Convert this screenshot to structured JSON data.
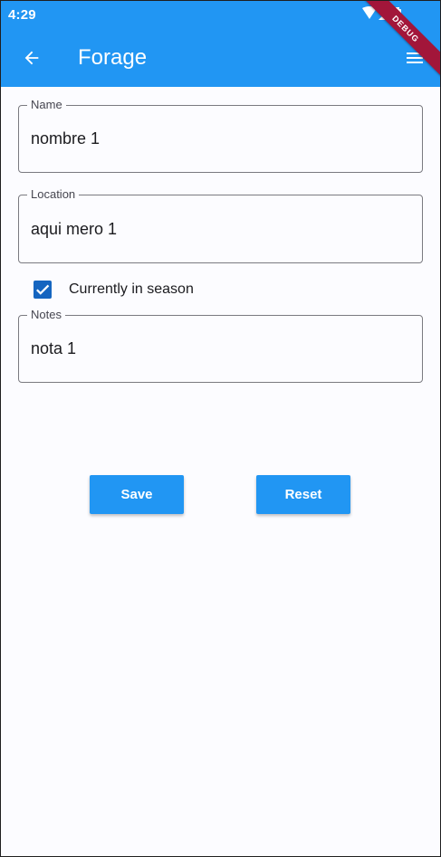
{
  "status_bar": {
    "time": "4:29",
    "icons": [
      "wifi-icon",
      "signal-icon",
      "battery-icon"
    ],
    "debug_banner": "DEBUG"
  },
  "app_bar": {
    "title": "Forage",
    "back_icon": "arrow-back-icon",
    "menu_icon": "menu-icon",
    "color": "#2196f3"
  },
  "form": {
    "name": {
      "label": "Name",
      "value": "nombre 1"
    },
    "location": {
      "label": "Location",
      "value": "aqui mero 1"
    },
    "in_season": {
      "label": "Currently in season",
      "checked": true
    },
    "notes": {
      "label": "Notes",
      "value": "nota 1"
    }
  },
  "actions": {
    "save_label": "Save",
    "reset_label": "Reset"
  },
  "colors": {
    "primary": "#2196f3",
    "checkbox": "#1565c0",
    "debug_ribbon": "#a2163a"
  }
}
